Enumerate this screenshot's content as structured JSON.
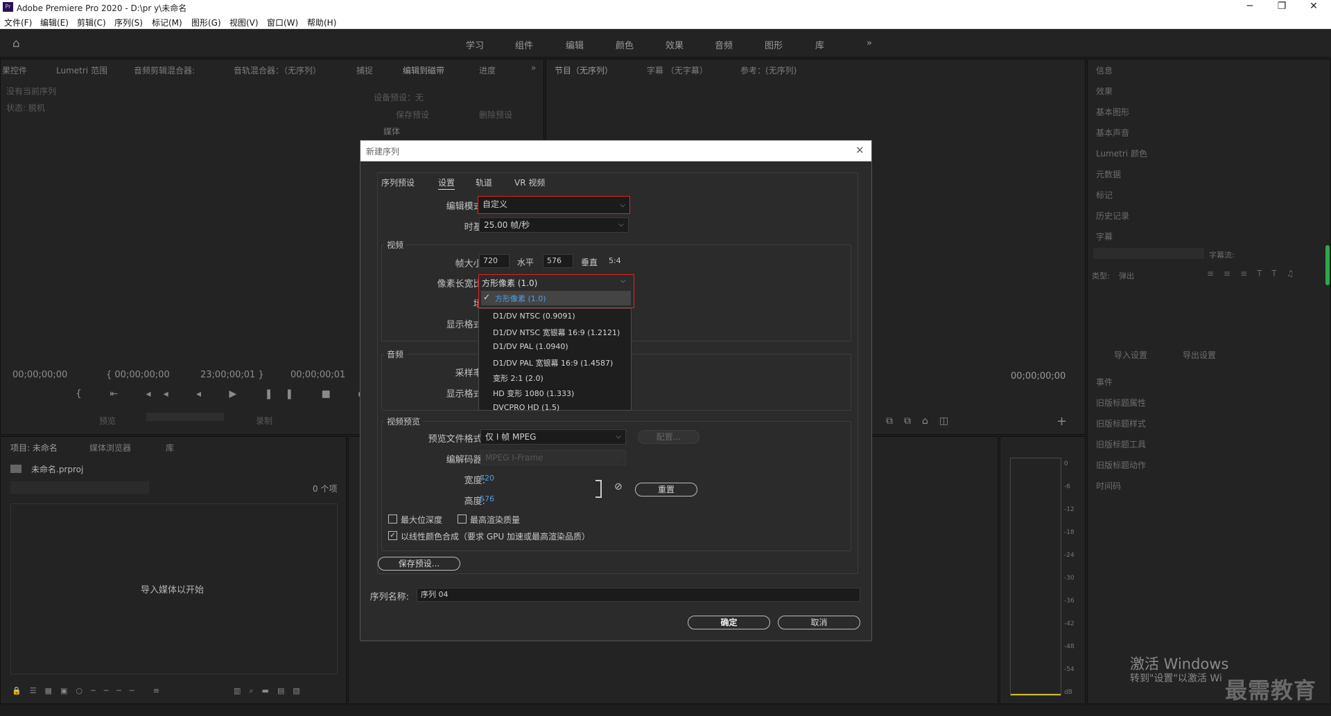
{
  "window": {
    "title": "Adobe Premiere Pro 2020 - D:\\pr y\\未命名",
    "logo": "Pr",
    "minimize": "─",
    "restore": "❐",
    "close": "✕"
  },
  "menu": [
    "文件(F)",
    "编辑(E)",
    "剪辑(C)",
    "序列(S)",
    "标记(M)",
    "图形(G)",
    "视图(V)",
    "窗口(W)",
    "帮助(H)"
  ],
  "workspaces": [
    "学习",
    "组件",
    "编辑",
    "颜色",
    "效果",
    "音频",
    "图形",
    "库"
  ],
  "workspace_more": "»",
  "source_panel": {
    "tabs": [
      "果控件",
      "Lumetri 范围",
      "音频剪辑混合器:",
      "音轨混合器：（无序列）",
      "捕捉",
      "编辑到磁带",
      "进度"
    ],
    "no_sequence": "没有当前序列",
    "status": "状态: 脱机",
    "preset_label": "设备预设：无",
    "save_preset": "保存预设",
    "delete_preset": "删除预设",
    "media": "媒体",
    "tc": [
      "00;00;00;00",
      "{ 00;00;00;00",
      "23;00;00;01 }",
      "00;00;00;01"
    ],
    "preview": "预览",
    "record": "录制"
  },
  "program_panel": {
    "tabs": [
      "节目（无序列）",
      "字幕 （无字幕）",
      "参考：(无序列)"
    ],
    "tc": "00;00;00;00"
  },
  "right_panel": {
    "items": [
      "信息",
      "效果",
      "基本图形",
      "基本声音",
      "Lumetri 颜色",
      "元数据",
      "标记",
      "历史记录",
      "字幕"
    ],
    "caption_stream": "字幕流:",
    "type_label": "类型:",
    "type_value": "弹出",
    "import_settings": "导入设置",
    "export_settings": "导出设置",
    "lower": [
      "事件",
      "旧版标题属性",
      "旧版标题样式",
      "旧版标题工具",
      "旧版标题动作",
      "时间码"
    ]
  },
  "project_panel": {
    "tabs": [
      "项目: 未命名",
      "媒体浏览器",
      "库"
    ],
    "file": "未命名.prproj",
    "count": "0 个项",
    "import_hint": "导入媒体以开始"
  },
  "meter": {
    "labels": [
      "0",
      "-6",
      "-12",
      "-18",
      "-24",
      "-30",
      "-36",
      "-42",
      "-48",
      "-54",
      "dB"
    ]
  },
  "dialog": {
    "title": "新建序列",
    "tabs": [
      "序列预设",
      "设置",
      "轨道",
      "VR 视频"
    ],
    "edit_mode_label": "编辑模式:",
    "edit_mode": "自定义",
    "timebase_label": "时基:",
    "timebase": "25.00  帧/秒",
    "video_group": "视频",
    "frame_size_label": "帧大小:",
    "frame_w": "720",
    "horizontal": "水平",
    "frame_h": "576",
    "vertical": "垂直",
    "ratio": "5:4",
    "par_label": "像素长宽比:",
    "par_value": "方形像素 (1.0)",
    "field_label": "场:",
    "display_format_label": "显示格式:",
    "audio_group": "音频",
    "sample_rate_label": "采样率:",
    "audio_display_label": "显示格式:",
    "preview_group": "视频预览",
    "preview_format_label": "预览文件格式:",
    "preview_format": "仅 I 帧 MPEG",
    "configure": "配置...",
    "codec_label": "编解码器:",
    "codec": "MPEG I-Frame",
    "width_label": "宽度:",
    "width": "720",
    "height_label": "高度:",
    "height": "576",
    "reset": "重置",
    "max_bit_depth": "最大位深度",
    "max_render": "最高渲染质量",
    "linear_color": "以线性颜色合成（要求 GPU 加速或最高渲染品质）",
    "save_preset": "保存预设...",
    "seq_name_label": "序列名称:",
    "seq_name": "序列 04",
    "ok": "确定",
    "cancel": "取消"
  },
  "dropdown": {
    "selected": "方形像素 (1.0)",
    "options": [
      "D1/DV NTSC (0.9091)",
      "D1/DV NTSC 宽银幕 16:9 (1.2121)",
      "D1/DV PAL (1.0940)",
      "D1/DV PAL 宽银幕 16:9 (1.4587)",
      "变形 2:1 (2.0)",
      "HD 变形 1080 (1.333)",
      "DVCPRO HD (1.5)"
    ]
  },
  "watermark": {
    "line1": "激活 Windows",
    "line2": "转到\"设置\"以激活 Wi",
    "brand": "最需教育"
  },
  "colors": {
    "accent": "#4f9fe8",
    "highlight": "#e02424",
    "bg": "#232323"
  }
}
